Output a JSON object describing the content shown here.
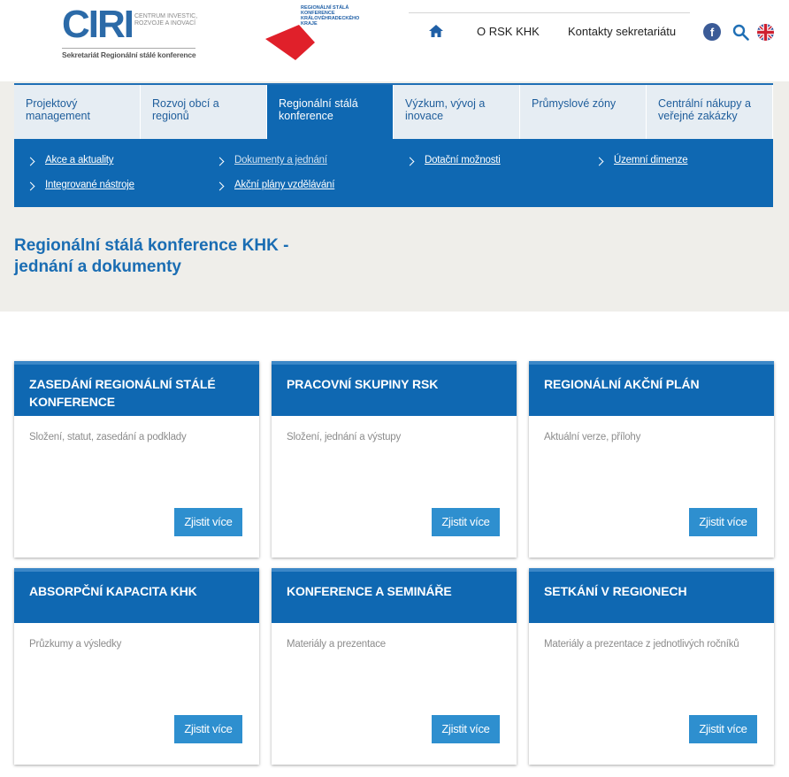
{
  "header": {
    "ciri_mark": "CIRI",
    "ciri_text": "CENTRUM INVESTIC, ROZVOJE A INOVACÍ",
    "ciri_subtitle": "Sekretariát Regionální stálé konference",
    "rsk_text": "REGIONÁLNÍ STÁLÁ KONFERENCE KRÁLOVÉHRADECKÉHO KRAJE",
    "nav": {
      "home_icon": "home-icon",
      "o_rsk": "O RSK KHK",
      "kontakty": "Kontakty sekretariátu"
    },
    "facebook_label": "f",
    "icons": [
      "facebook-icon",
      "search-icon",
      "uk-flag-icon"
    ]
  },
  "main_nav": [
    {
      "label": "Projektový management"
    },
    {
      "label": "Rozvoj obcí a regionů"
    },
    {
      "label": "Regionální stálá konference"
    },
    {
      "label": "Výzkum, vývoj a inovace"
    },
    {
      "label": "Průmyslové zóny"
    },
    {
      "label": "Centrální nákupy a veřejné zakázky"
    }
  ],
  "sub_nav": [
    {
      "label": "Akce a aktuality"
    },
    {
      "label": "Dokumenty a jednání"
    },
    {
      "label": "Dotační možnosti"
    },
    {
      "label": "Územní dimenze"
    },
    {
      "label": "Integrované nástroje"
    },
    {
      "label": "Akční plány vzdělávání"
    }
  ],
  "page_title": "Regionální stálá konference KHK - jednání a dokumenty",
  "cards": [
    {
      "title": "ZASEDÁNÍ REGIONÁLNÍ STÁLÉ KONFERENCE",
      "desc": "Složení, statut, zasedání a podklady",
      "button": "Zjistit více"
    },
    {
      "title": "PRACOVNÍ SKUPINY RSK",
      "desc": "Složení, jednání a výstupy",
      "button": "Zjistit více"
    },
    {
      "title": "REGIONÁLNÍ AKČNÍ PLÁN",
      "desc": "Aktuální verze, přílohy",
      "button": "Zjistit více"
    },
    {
      "title": "ABSORPČNÍ KAPACITA KHK",
      "desc": "Průzkumy a výsledky",
      "button": "Zjistit více"
    },
    {
      "title": "KONFERENCE A SEMINÁŘE",
      "desc": "Materiály a prezentace",
      "button": "Zjistit více"
    },
    {
      "title": "SETKÁNÍ V REGIONECH",
      "desc": "Materiály a prezentace z jednotlivých ročníků",
      "button": "Zjistit více"
    }
  ],
  "colors": {
    "primary_blue": "#0f68b2",
    "button_blue": "#2e8fcf",
    "band_gray": "#efeeea",
    "tab_bg": "#e6edf3"
  }
}
